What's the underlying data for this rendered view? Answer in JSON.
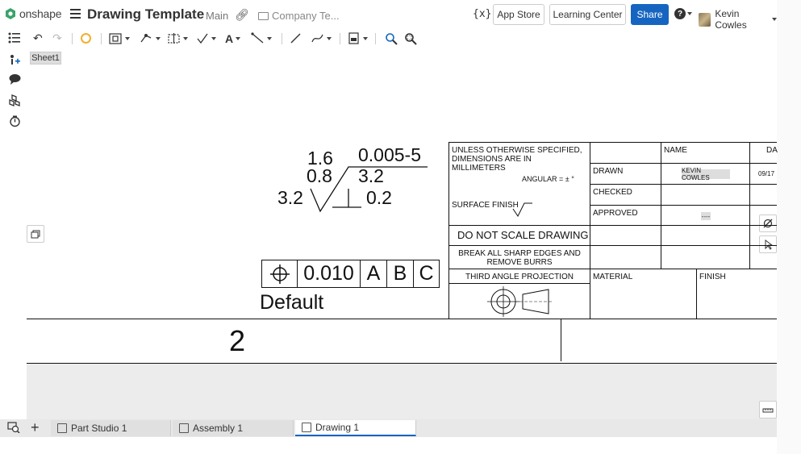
{
  "header": {
    "brand": "onshape",
    "doc_title": "Drawing Template",
    "branch": "Main",
    "folder": "Company Te...",
    "variables_icon": "{x}",
    "app_store": "App Store",
    "learning_center": "Learning Center",
    "share": "Share",
    "help_icon": "?",
    "user_name": "Kevin Cowles"
  },
  "sheet": {
    "tab_label": "Sheet1"
  },
  "drawing": {
    "surface_finish": {
      "top_left": "1.6",
      "mid_left": "0.8",
      "bottom_left": "3.2",
      "top_right": "0.005-5",
      "mid_right": "3.2",
      "bottom_right": "0.2"
    },
    "feature_control_frame": {
      "symbol": "⌖",
      "tolerance": "0.010",
      "datum_a": "A",
      "datum_b": "B",
      "datum_c": "C"
    },
    "default_label": "Default",
    "view_number": "2"
  },
  "title_block": {
    "unless_specified": "UNLESS OTHERWISE SPECIFIED, DIMENSIONS ARE IN MILLIMETERS",
    "angular": "ANGULAR = ± °",
    "surface_finish_label": "SURFACE FINISH",
    "do_not_scale": "DO NOT SCALE DRAWING",
    "break_edges": "BREAK ALL SHARP EDGES AND REMOVE BURRS",
    "projection": "THIRD ANGLE PROJECTION",
    "name_header": "NAME",
    "date_header": "DA",
    "drawn": "DRAWN",
    "checked": "CHECKED",
    "approved": "APPROVED",
    "drawn_by": "KEVIN COWLES",
    "drawn_date": "09/17",
    "approved_value": "----",
    "material": "MATERIAL",
    "finish": "FINISH"
  },
  "bottom_tabs": [
    {
      "label": "Part Studio 1"
    },
    {
      "label": "Assembly 1"
    },
    {
      "label": "Drawing 1"
    }
  ],
  "colors": {
    "accent": "#1565c0",
    "canvas_bg": "#ffffff",
    "below_sheet": "#ececec"
  }
}
